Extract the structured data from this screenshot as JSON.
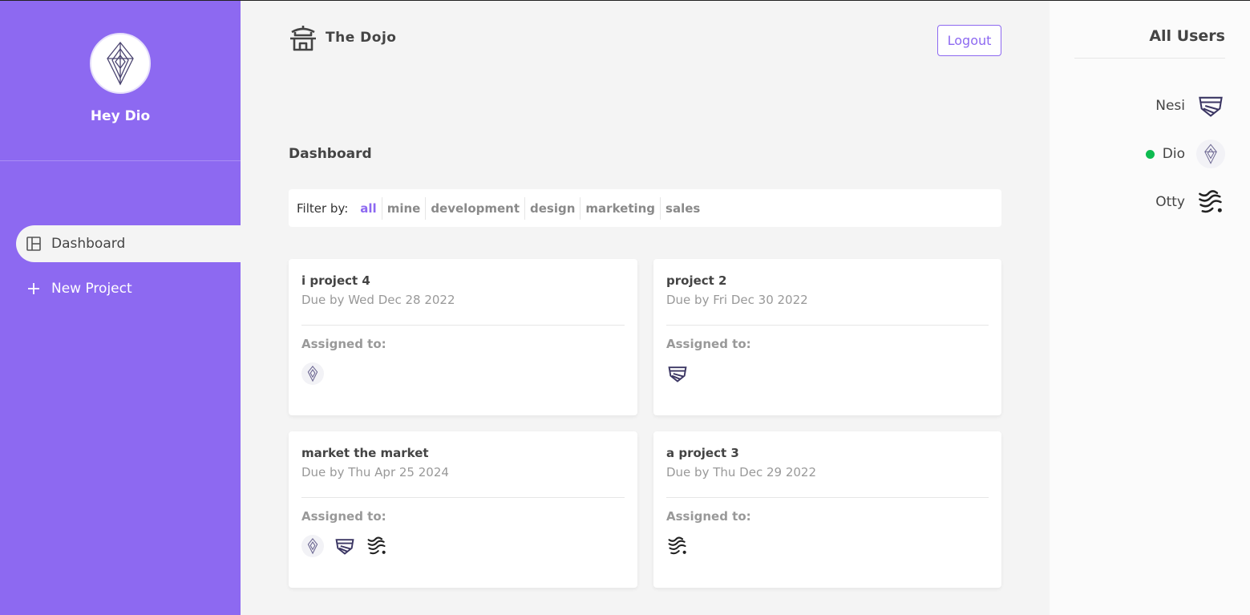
{
  "sidebar": {
    "greeting": "Hey Dio",
    "avatar_icon": "geometric-diamond-avatar",
    "nav": [
      {
        "label": "Dashboard",
        "icon": "dashboard-icon",
        "active": true
      },
      {
        "label": "New Project",
        "icon": "plus-icon",
        "active": false
      }
    ],
    "background": "#8d69f1"
  },
  "header": {
    "brand": "The Dojo",
    "brand_icon": "temple-icon",
    "logout_label": "Logout"
  },
  "dashboard": {
    "title": "Dashboard",
    "filter_label": "Filter by:",
    "filters": [
      "all",
      "mine",
      "development",
      "design",
      "marketing",
      "sales"
    ],
    "active_filter": "all"
  },
  "projects": [
    {
      "name": "i project 4",
      "due": "Due by Wed Dec 28 2022",
      "assigned_label": "Assigned to:",
      "assigned": [
        "Dio"
      ]
    },
    {
      "name": "project 2",
      "due": "Due by Fri Dec 30 2022",
      "assigned_label": "Assigned to:",
      "assigned": [
        "Nesi"
      ]
    },
    {
      "name": "market the market",
      "due": "Due by Thu Apr 25 2024",
      "assigned_label": "Assigned to:",
      "assigned": [
        "Dio",
        "Nesi",
        "Otty"
      ]
    },
    {
      "name": "a project 3",
      "due": "Due by Thu Dec 29 2022",
      "assigned_label": "Assigned to:",
      "assigned": [
        "Otty"
      ]
    }
  ],
  "users_panel": {
    "title": "All Users",
    "users": [
      {
        "name": "Nesi",
        "online": false,
        "avatar": "striped-shield-avatar"
      },
      {
        "name": "Dio",
        "online": true,
        "avatar": "geometric-diamond-avatar"
      },
      {
        "name": "Otty",
        "online": false,
        "avatar": "wavy-lines-avatar"
      }
    ]
  },
  "colors": {
    "accent": "#8d69f1",
    "online": "#0ebb50",
    "background": "#f4f4f4"
  }
}
